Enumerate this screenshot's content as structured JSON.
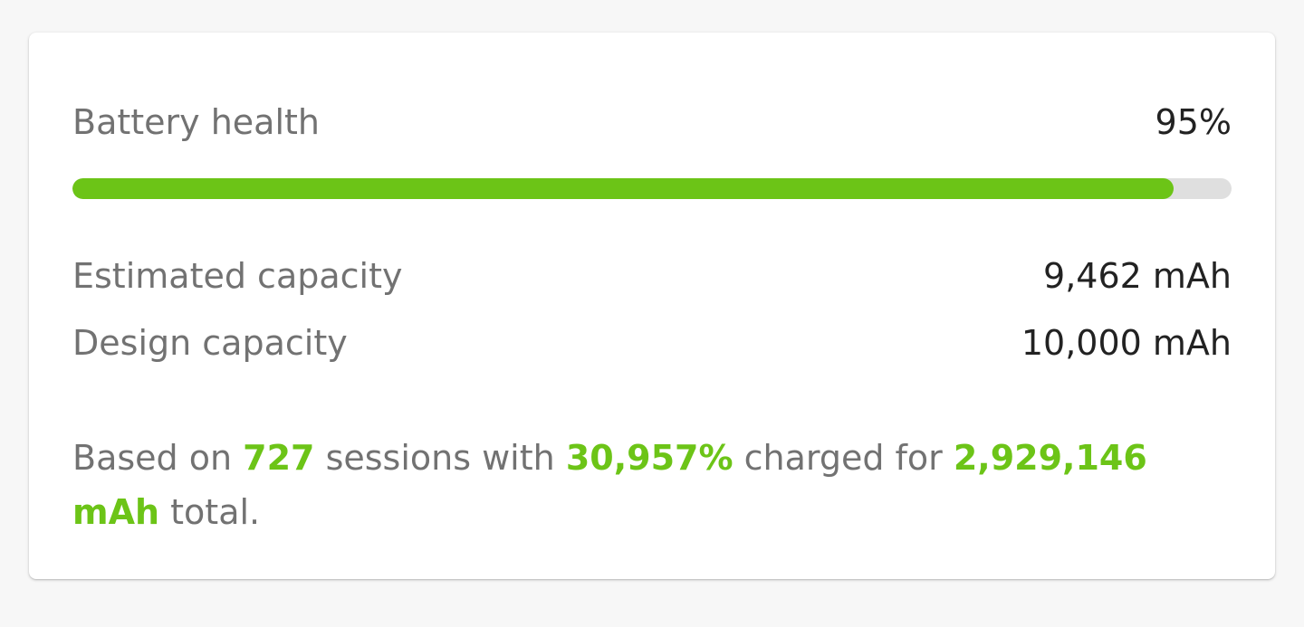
{
  "battery": {
    "health_label": "Battery health",
    "health_value": "95%",
    "health_fraction": 0.95,
    "estimated_label": "Estimated capacity",
    "estimated_value": "9,462 mAh",
    "design_label": "Design capacity",
    "design_value": "10,000 mAh"
  },
  "summary": {
    "t1": "Based on ",
    "sessions": "727",
    "t2": " sessions with ",
    "charged_pct": "30,957%",
    "t3": " charged for ",
    "total": "2,929,146 mAh",
    "t4": " total."
  },
  "colors": {
    "accent": "#6cc417",
    "track": "#dfdfdf",
    "label": "#727272",
    "value": "#222222"
  }
}
